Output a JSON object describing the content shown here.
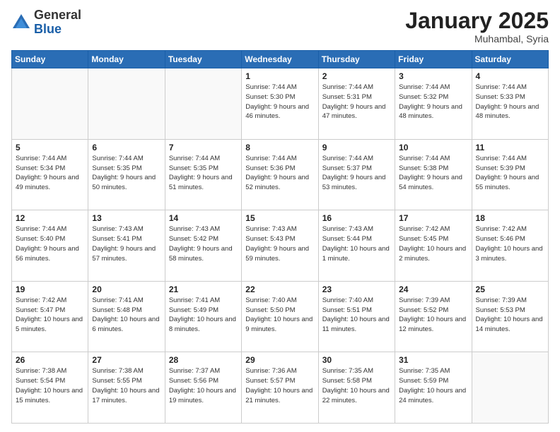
{
  "logo": {
    "general": "General",
    "blue": "Blue"
  },
  "header": {
    "month": "January 2025",
    "location": "Muhambal, Syria"
  },
  "days_of_week": [
    "Sunday",
    "Monday",
    "Tuesday",
    "Wednesday",
    "Thursday",
    "Friday",
    "Saturday"
  ],
  "weeks": [
    [
      {
        "day": "",
        "info": ""
      },
      {
        "day": "",
        "info": ""
      },
      {
        "day": "",
        "info": ""
      },
      {
        "day": "1",
        "info": "Sunrise: 7:44 AM\nSunset: 5:30 PM\nDaylight: 9 hours and 46 minutes."
      },
      {
        "day": "2",
        "info": "Sunrise: 7:44 AM\nSunset: 5:31 PM\nDaylight: 9 hours and 47 minutes."
      },
      {
        "day": "3",
        "info": "Sunrise: 7:44 AM\nSunset: 5:32 PM\nDaylight: 9 hours and 48 minutes."
      },
      {
        "day": "4",
        "info": "Sunrise: 7:44 AM\nSunset: 5:33 PM\nDaylight: 9 hours and 48 minutes."
      }
    ],
    [
      {
        "day": "5",
        "info": "Sunrise: 7:44 AM\nSunset: 5:34 PM\nDaylight: 9 hours and 49 minutes."
      },
      {
        "day": "6",
        "info": "Sunrise: 7:44 AM\nSunset: 5:35 PM\nDaylight: 9 hours and 50 minutes."
      },
      {
        "day": "7",
        "info": "Sunrise: 7:44 AM\nSunset: 5:35 PM\nDaylight: 9 hours and 51 minutes."
      },
      {
        "day": "8",
        "info": "Sunrise: 7:44 AM\nSunset: 5:36 PM\nDaylight: 9 hours and 52 minutes."
      },
      {
        "day": "9",
        "info": "Sunrise: 7:44 AM\nSunset: 5:37 PM\nDaylight: 9 hours and 53 minutes."
      },
      {
        "day": "10",
        "info": "Sunrise: 7:44 AM\nSunset: 5:38 PM\nDaylight: 9 hours and 54 minutes."
      },
      {
        "day": "11",
        "info": "Sunrise: 7:44 AM\nSunset: 5:39 PM\nDaylight: 9 hours and 55 minutes."
      }
    ],
    [
      {
        "day": "12",
        "info": "Sunrise: 7:44 AM\nSunset: 5:40 PM\nDaylight: 9 hours and 56 minutes."
      },
      {
        "day": "13",
        "info": "Sunrise: 7:43 AM\nSunset: 5:41 PM\nDaylight: 9 hours and 57 minutes."
      },
      {
        "day": "14",
        "info": "Sunrise: 7:43 AM\nSunset: 5:42 PM\nDaylight: 9 hours and 58 minutes."
      },
      {
        "day": "15",
        "info": "Sunrise: 7:43 AM\nSunset: 5:43 PM\nDaylight: 9 hours and 59 minutes."
      },
      {
        "day": "16",
        "info": "Sunrise: 7:43 AM\nSunset: 5:44 PM\nDaylight: 10 hours and 1 minute."
      },
      {
        "day": "17",
        "info": "Sunrise: 7:42 AM\nSunset: 5:45 PM\nDaylight: 10 hours and 2 minutes."
      },
      {
        "day": "18",
        "info": "Sunrise: 7:42 AM\nSunset: 5:46 PM\nDaylight: 10 hours and 3 minutes."
      }
    ],
    [
      {
        "day": "19",
        "info": "Sunrise: 7:42 AM\nSunset: 5:47 PM\nDaylight: 10 hours and 5 minutes."
      },
      {
        "day": "20",
        "info": "Sunrise: 7:41 AM\nSunset: 5:48 PM\nDaylight: 10 hours and 6 minutes."
      },
      {
        "day": "21",
        "info": "Sunrise: 7:41 AM\nSunset: 5:49 PM\nDaylight: 10 hours and 8 minutes."
      },
      {
        "day": "22",
        "info": "Sunrise: 7:40 AM\nSunset: 5:50 PM\nDaylight: 10 hours and 9 minutes."
      },
      {
        "day": "23",
        "info": "Sunrise: 7:40 AM\nSunset: 5:51 PM\nDaylight: 10 hours and 11 minutes."
      },
      {
        "day": "24",
        "info": "Sunrise: 7:39 AM\nSunset: 5:52 PM\nDaylight: 10 hours and 12 minutes."
      },
      {
        "day": "25",
        "info": "Sunrise: 7:39 AM\nSunset: 5:53 PM\nDaylight: 10 hours and 14 minutes."
      }
    ],
    [
      {
        "day": "26",
        "info": "Sunrise: 7:38 AM\nSunset: 5:54 PM\nDaylight: 10 hours and 15 minutes."
      },
      {
        "day": "27",
        "info": "Sunrise: 7:38 AM\nSunset: 5:55 PM\nDaylight: 10 hours and 17 minutes."
      },
      {
        "day": "28",
        "info": "Sunrise: 7:37 AM\nSunset: 5:56 PM\nDaylight: 10 hours and 19 minutes."
      },
      {
        "day": "29",
        "info": "Sunrise: 7:36 AM\nSunset: 5:57 PM\nDaylight: 10 hours and 21 minutes."
      },
      {
        "day": "30",
        "info": "Sunrise: 7:35 AM\nSunset: 5:58 PM\nDaylight: 10 hours and 22 minutes."
      },
      {
        "day": "31",
        "info": "Sunrise: 7:35 AM\nSunset: 5:59 PM\nDaylight: 10 hours and 24 minutes."
      },
      {
        "day": "",
        "info": ""
      }
    ]
  ]
}
